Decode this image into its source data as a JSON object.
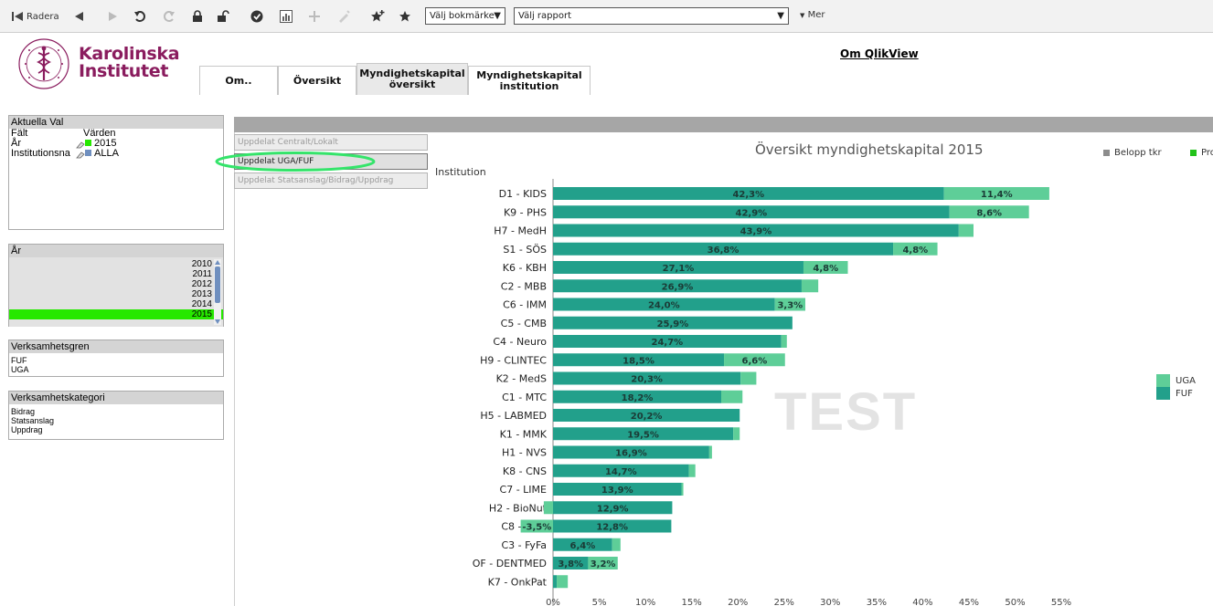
{
  "toolbar": {
    "radera_label": "Radera",
    "bookmark_select": "Välj bokmärke",
    "report_select": "Välj rapport",
    "more_label": "Mer"
  },
  "header": {
    "logo_line1": "Karolinska",
    "logo_line2": "Institutet",
    "about_link": "Om QlikView",
    "tabs": [
      {
        "line1": "Om..",
        "line2": ""
      },
      {
        "line1": "Översikt",
        "line2": ""
      },
      {
        "line1": "Myndighetskapital",
        "line2": "översikt"
      },
      {
        "line1": "Myndighetskapital",
        "line2": "institution"
      }
    ]
  },
  "current_selections": {
    "title": "Aktuella Val",
    "field_header": "Fält",
    "values_header": "Värden",
    "rows": [
      {
        "field": "År",
        "value": "2015"
      },
      {
        "field": "Institutionsna",
        "value": "ALLA"
      }
    ]
  },
  "year_listbox": {
    "title": "År",
    "items": [
      "2010",
      "2011",
      "2012",
      "2013",
      "2014",
      "2015"
    ],
    "selected": "2015"
  },
  "verksamhetsgren": {
    "title": "Verksamhetsgren",
    "items": [
      "FUF",
      "UGA"
    ]
  },
  "verksamhetskategori": {
    "title": "Verksamhetskategori",
    "items": [
      "Bidrag",
      "Statsanslag",
      "Uppdrag"
    ]
  },
  "split_buttons": [
    {
      "label": "Uppdelat Centralt/Lokalt",
      "active": false
    },
    {
      "label": "Uppdelat UGA/FUF",
      "active": true
    },
    {
      "label": "Uppdelat Statsanslag/Bidrag/Uppdrag",
      "active": false
    }
  ],
  "watermark": "TEST",
  "top_legend": [
    {
      "label": "Belopp tkr",
      "color": "#8c8c8c"
    },
    {
      "label": "Pro",
      "color": "#22c21a"
    }
  ],
  "colors": {
    "fuf": "#22a08b",
    "uga": "#5ece98",
    "highlight_ring": "#34e46a",
    "selected_year": "#27e800"
  },
  "chart_data": {
    "type": "bar",
    "orientation": "horizontal",
    "stacked": true,
    "title": "Översikt myndighetskapital 2015",
    "ylabel": "Institution",
    "xlim": [
      0,
      55
    ],
    "x_ticks": [
      "0%",
      "5%",
      "10%",
      "15%",
      "20%",
      "25%",
      "30%",
      "35%",
      "40%",
      "45%",
      "50%",
      "55%"
    ],
    "categories": [
      "D1 - KIDS",
      "K9 - PHS",
      "H7 - MedH",
      "S1 - SÖS",
      "K6 - KBH",
      "C2 - MBB",
      "C6 - IMM",
      "C5 - CMB",
      "C4 - Neuro",
      "H9 - CLINTEC",
      "K2 - MedS",
      "C1 - MTC",
      "H5 - LABMED",
      "K1 - MMK",
      "H1 - NVS",
      "K8 - CNS",
      "C7 - LIME",
      "H2 - BioNut",
      "C8 - MEB",
      "C3 - FyFa",
      "OF - DENTMED",
      "K7 - OnkPat"
    ],
    "series": [
      {
        "name": "FUF",
        "values": [
          42.3,
          42.9,
          43.9,
          36.8,
          27.1,
          26.9,
          24.0,
          25.9,
          24.7,
          18.5,
          20.3,
          18.2,
          20.2,
          19.5,
          16.9,
          14.7,
          13.9,
          12.9,
          12.8,
          6.4,
          3.8,
          0.4
        ],
        "labels": [
          "42,3%",
          "42,9%",
          "43,9%",
          "36,8%",
          "27,1%",
          "26,9%",
          "24,0%",
          "25,9%",
          "24,7%",
          "18,5%",
          "20,3%",
          "18,2%",
          "20,2%",
          "19,5%",
          "16,9%",
          "14,7%",
          "13,9%",
          "12,9%",
          "12,8%",
          "6,4%",
          "3,8%",
          ""
        ]
      },
      {
        "name": "UGA",
        "values": [
          11.4,
          8.6,
          1.6,
          4.8,
          4.8,
          1.8,
          3.3,
          0.0,
          0.6,
          6.6,
          1.7,
          2.3,
          0.0,
          0.7,
          0.3,
          0.7,
          0.2,
          -1.0,
          -3.5,
          0.9,
          3.2,
          1.2
        ],
        "labels": [
          "11,4%",
          "8,6%",
          "",
          "4,8%",
          "4,8%",
          "",
          "3,3%",
          "",
          "",
          "6,6%",
          "",
          "",
          "",
          "",
          "",
          "",
          "",
          "",
          "-3,5%",
          "",
          "3,2%",
          ""
        ]
      }
    ],
    "legend": [
      {
        "name": "UGA",
        "color": "#5ece98"
      },
      {
        "name": "FUF",
        "color": "#22a08b"
      }
    ]
  }
}
